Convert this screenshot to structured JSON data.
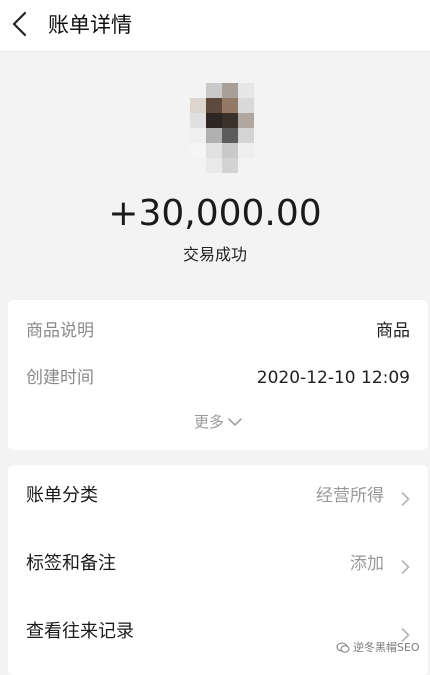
{
  "header": {
    "title": "账单详情",
    "back_icon": "chevron-left-icon"
  },
  "summary": {
    "amount": "+30,000.00",
    "status": "交易成功",
    "avatar": "pixelated-avatar"
  },
  "details": {
    "rows": [
      {
        "label": "商品说明",
        "value": "商品"
      },
      {
        "label": "创建时间",
        "value": "2020-12-10 12:09"
      }
    ],
    "more_label": "更多",
    "more_icon": "chevron-down-icon"
  },
  "actions": {
    "items": [
      {
        "label": "账单分类",
        "value": "经营所得",
        "icon": "chevron-right-icon"
      },
      {
        "label": "标签和备注",
        "value": "添加",
        "icon": "chevron-right-icon"
      },
      {
        "label": "查看往来记录",
        "value": "",
        "icon": "chevron-right-icon"
      }
    ]
  },
  "watermark": {
    "text": "逆冬黑帽SEO",
    "icon": "chat-bubble-icon"
  },
  "colors": {
    "background": "#f3f3f3",
    "card": "#ffffff",
    "muted_text": "#8a8a8a",
    "primary_text": "#1a1a1a"
  }
}
